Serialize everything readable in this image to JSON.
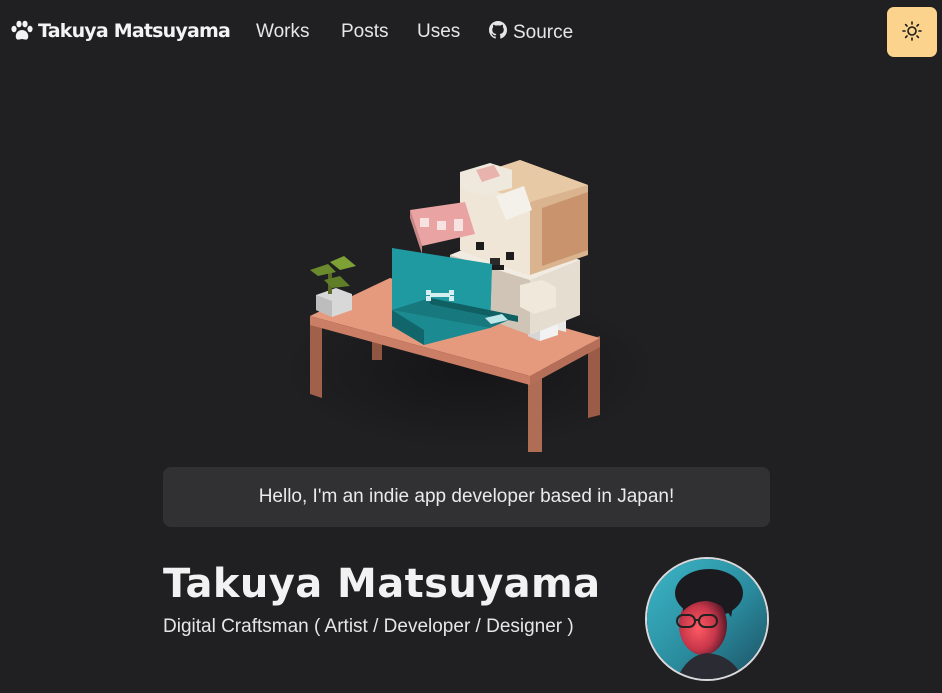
{
  "header": {
    "logo_text": "Takuya Matsuyama",
    "logo_icon": "paw-icon",
    "nav": [
      {
        "label": "Works"
      },
      {
        "label": "Posts"
      },
      {
        "label": "Uses"
      },
      {
        "label": "Source",
        "icon": "github-icon"
      }
    ],
    "theme_toggle_icon": "sun-icon",
    "theme_toggle_color": "#fbd38d"
  },
  "hero": {
    "illustration": "voxel-dog-at-desk",
    "greeting": "Hello, I'm an indie app developer based in Japan!"
  },
  "profile": {
    "name": "Takuya Matsuyama",
    "tagline": "Digital Craftsman ( Artist / Developer / Designer )",
    "avatar": "profile-photo"
  },
  "colors": {
    "background": "#202023",
    "card": "#313134",
    "accent": "#fbd38d"
  }
}
